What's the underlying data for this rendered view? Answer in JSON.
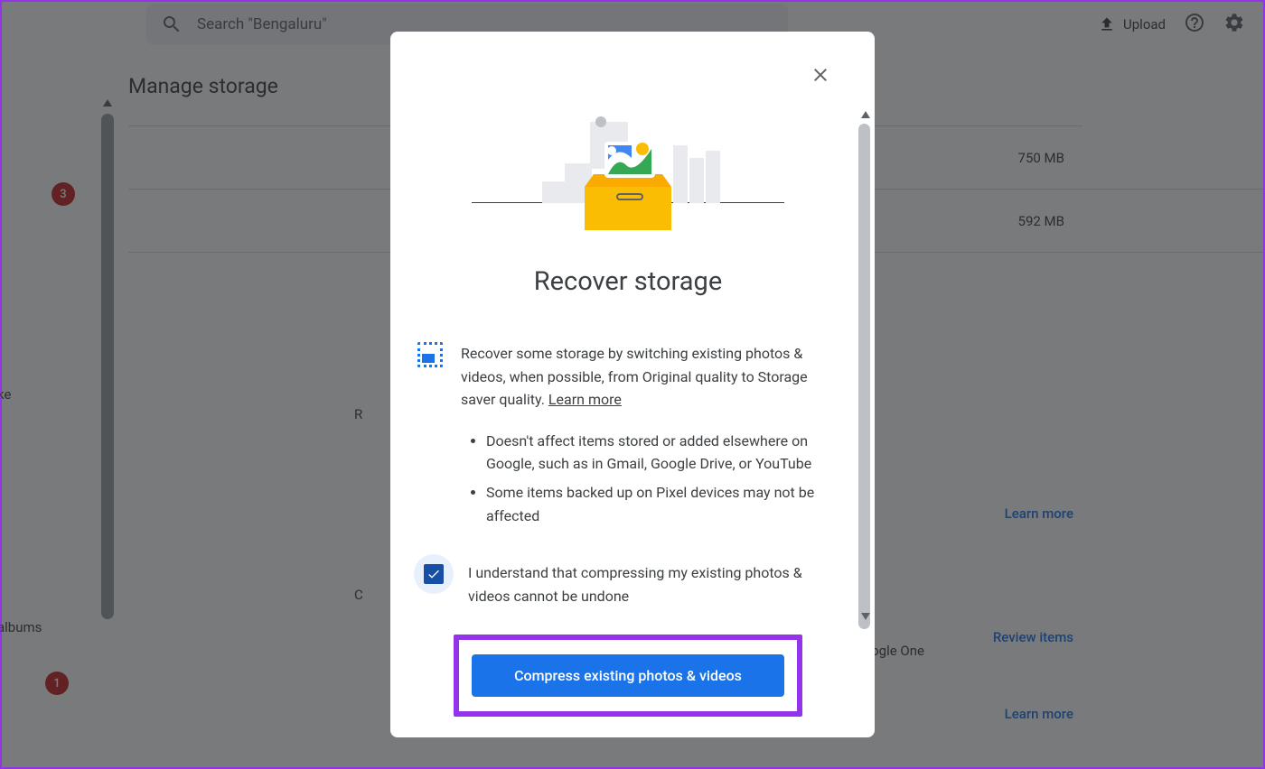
{
  "header": {
    "search_placeholder": "Search \"Bengaluru\"",
    "upload_label": "Upload"
  },
  "sidebar": {
    "badge_top": "3",
    "text_mid": "ke",
    "text_albums": "albums",
    "badge_bottom": "1"
  },
  "page": {
    "title": "Manage storage",
    "storage_rows": [
      "750 MB",
      "592 MB"
    ],
    "learn_more": "Learn more",
    "google_one": "Google One",
    "review_items": "Review items",
    "section_letters": {
      "r": "R",
      "c": "C"
    }
  },
  "dialog": {
    "title": "Recover storage",
    "description": "Recover some storage by switching existing photos & videos, when possible, from Original quality to Storage saver quality. ",
    "learn_more": "Learn more",
    "bullets": [
      "Doesn't affect items stored or added elsewhere on Google, such as in Gmail, Google Drive, or YouTube",
      "Some items backed up on Pixel devices may not be affected"
    ],
    "checkbox_label": "I understand that compressing my existing photos & videos cannot be undone",
    "checkbox_checked": true,
    "primary_button": "Compress existing photos & videos"
  }
}
